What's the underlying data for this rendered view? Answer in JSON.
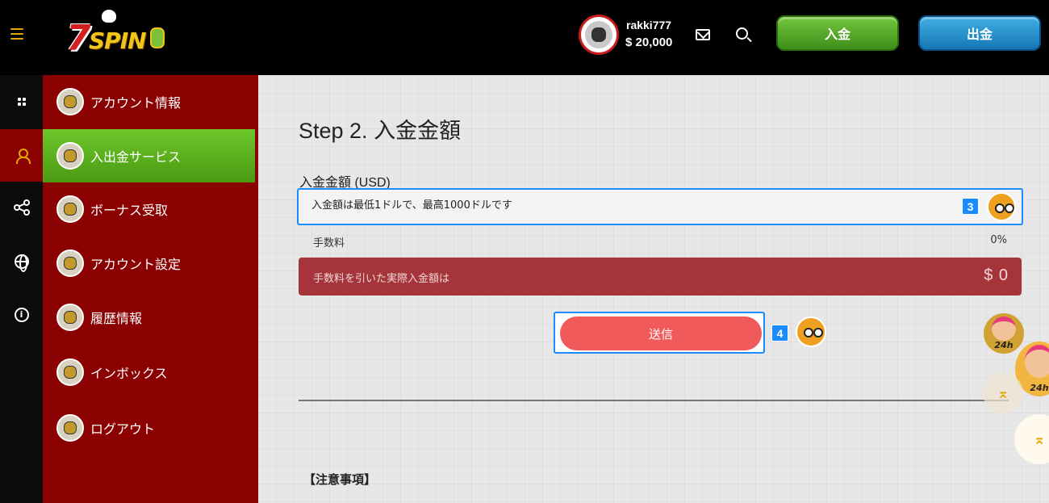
{
  "header": {
    "logo_text": "7SPIN",
    "user": {
      "name": "rakki777",
      "balance": "$ 20,000"
    },
    "deposit_label": "入金",
    "withdraw_label": "出金",
    "icons": [
      "hamburger-icon",
      "mail-icon",
      "search-icon"
    ]
  },
  "rail": {
    "icons": [
      "dashboard-icon",
      "user-icon",
      "share-icon",
      "globe-icon",
      "info-icon"
    ],
    "active_index": 1
  },
  "menu": {
    "items": [
      {
        "label": "アカウント情報",
        "icon": "account-info-icon"
      },
      {
        "label": "入出金サービス",
        "icon": "payment-icon"
      },
      {
        "label": "ボーナス受取",
        "icon": "bonus-icon"
      },
      {
        "label": "アカウント設定",
        "icon": "settings-icon"
      },
      {
        "label": "履歴情報",
        "icon": "history-icon"
      },
      {
        "label": "インボックス",
        "icon": "inbox-icon"
      },
      {
        "label": "ログアウト",
        "icon": "logout-icon"
      }
    ],
    "active_index": 1
  },
  "main": {
    "step_title": "Step 2. 入金金額",
    "amount_label": "入金金額 (USD)",
    "amount_placeholder": "入金額は最低1ドルで、最高1000ドルです",
    "amount_badge": "3",
    "fee_label": "手数料",
    "fee_value": "0%",
    "net_label": "手数料を引いた実際入金額は",
    "net_value": "$ 0",
    "send_label": "送信",
    "send_badge": "4",
    "notes_title": "【注意事項】"
  },
  "floating": {
    "support_label": "24h",
    "scroll_top_icon": "chevron-up-icon"
  },
  "colors": {
    "header_bg": "#000000",
    "menu_bg": "#8b0000",
    "menu_active": "#5aad1c",
    "accent_gold": "#e0a800",
    "deposit_green": "#4aa021",
    "withdraw_blue": "#1f8ccc",
    "net_box": "#a5353b",
    "send_button": "#f05a5a",
    "focus_blue": "#1a8cff"
  }
}
